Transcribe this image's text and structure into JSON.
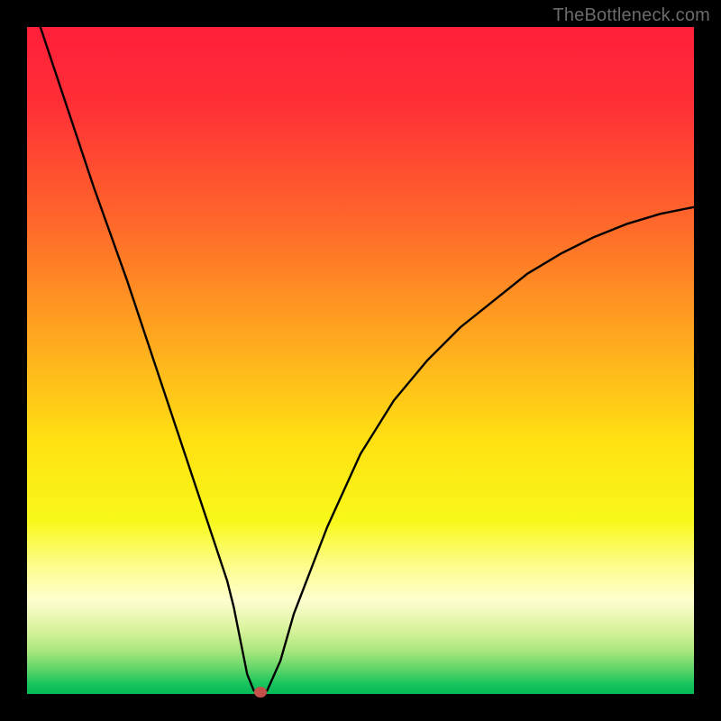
{
  "watermark": "TheBottleneck.com",
  "chart_data": {
    "type": "line",
    "title": "",
    "xlabel": "",
    "ylabel": "",
    "xlim": [
      0,
      100
    ],
    "ylim": [
      0,
      100
    ],
    "grid": false,
    "legend": false,
    "series": [
      {
        "name": "curve",
        "x": [
          2,
          5,
          10,
          15,
          20,
          25,
          28,
          30,
          31,
          32,
          33,
          34,
          35,
          36,
          38,
          40,
          45,
          50,
          55,
          60,
          65,
          70,
          75,
          80,
          85,
          90,
          95,
          100
        ],
        "values": [
          100,
          91,
          76,
          62,
          47,
          32,
          23,
          17,
          13,
          8,
          3,
          0.5,
          0.3,
          0.5,
          5,
          12,
          25,
          36,
          44,
          50,
          55,
          59,
          63,
          66,
          68.5,
          70.5,
          72,
          73
        ]
      }
    ],
    "marker": {
      "x": 35,
      "y": 0.3
    },
    "gradient_stops": [
      {
        "pos": 0.0,
        "color": "#ff1f3a"
      },
      {
        "pos": 0.12,
        "color": "#ff3036"
      },
      {
        "pos": 0.3,
        "color": "#ff6a2a"
      },
      {
        "pos": 0.48,
        "color": "#ffad1e"
      },
      {
        "pos": 0.62,
        "color": "#ffe012"
      },
      {
        "pos": 0.74,
        "color": "#f8f81a"
      },
      {
        "pos": 0.81,
        "color": "#fdfd8f"
      },
      {
        "pos": 0.86,
        "color": "#fefecf"
      },
      {
        "pos": 0.905,
        "color": "#d7f29a"
      },
      {
        "pos": 0.935,
        "color": "#a9e77d"
      },
      {
        "pos": 0.965,
        "color": "#58d466"
      },
      {
        "pos": 0.985,
        "color": "#18c45e"
      },
      {
        "pos": 1.0,
        "color": "#06b957"
      }
    ]
  }
}
